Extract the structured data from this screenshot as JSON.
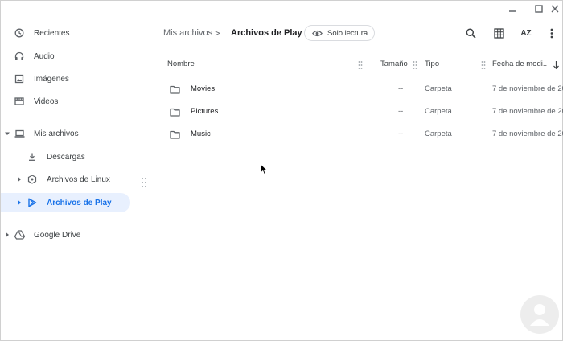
{
  "window": {
    "controls": [
      "minimize",
      "maximize",
      "close"
    ]
  },
  "sidebar": {
    "items": [
      {
        "label": "Recientes",
        "icon": "clock-icon"
      },
      {
        "label": "Audio",
        "icon": "headphones-icon"
      },
      {
        "label": "Imágenes",
        "icon": "image-icon"
      },
      {
        "label": "Videos",
        "icon": "film-icon"
      },
      {
        "label": "Mis archivos",
        "icon": "laptop-icon",
        "expanded": true
      },
      {
        "label": "Descargas",
        "icon": "download-icon"
      },
      {
        "label": "Archivos de Linux",
        "icon": "linux-icon"
      },
      {
        "label": "Archivos de Play",
        "icon": "play-store-icon",
        "selected": true
      },
      {
        "label": "Google Drive",
        "icon": "drive-icon"
      }
    ]
  },
  "breadcrumb": {
    "root": "Mis archivos",
    "separator": ">",
    "current": "Archivos de Play"
  },
  "readonly_chip": {
    "label": "Solo lectura",
    "icon": "eye-icon"
  },
  "toolbar": {
    "buttons": [
      "search-icon",
      "grid-view-icon",
      "sort-az-icon",
      "more-vert-icon"
    ],
    "sort_label": "AZ"
  },
  "table": {
    "columns": [
      "Nombre",
      "Tamaño",
      "Tipo",
      "Fecha de modi..."
    ],
    "sort_column": "Fecha de modi...",
    "sort_direction": "descending",
    "rows": [
      {
        "name": "Movies",
        "size": "--",
        "type": "Carpeta",
        "date": "7 de noviembre de 20..."
      },
      {
        "name": "Pictures",
        "size": "--",
        "type": "Carpeta",
        "date": "7 de noviembre de 20..."
      },
      {
        "name": "Music",
        "size": "--",
        "type": "Carpeta",
        "date": "7 de noviembre de 20..."
      }
    ]
  },
  "colors": {
    "accent": "#1a73e8",
    "selected_bg": "#e8f0fe",
    "text": "#3c4043",
    "secondary_text": "#5f6368"
  }
}
